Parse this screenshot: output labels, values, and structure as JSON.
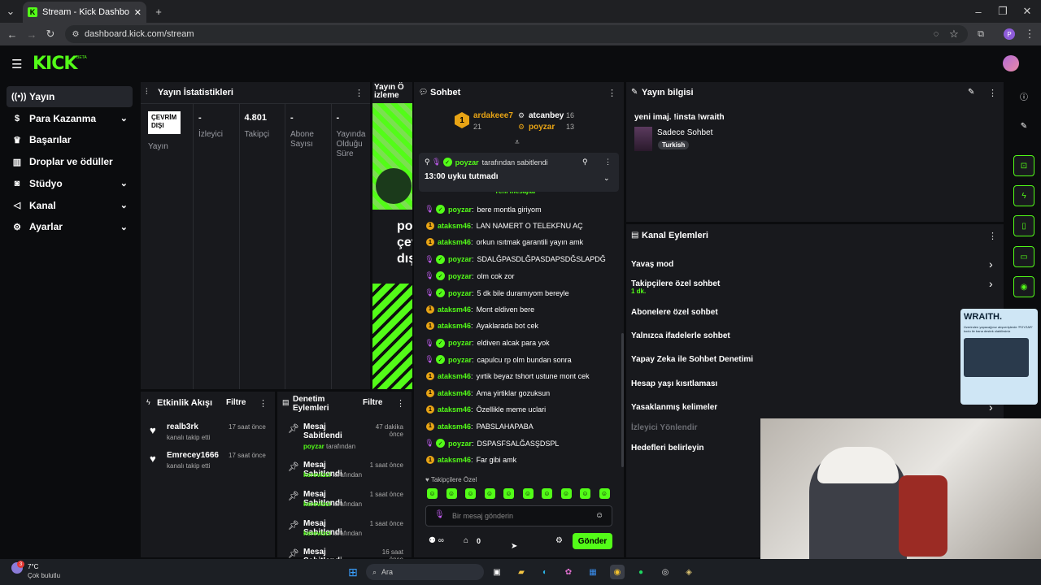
{
  "browser": {
    "tab_title": "Stream - Kick Dashboard",
    "url": "dashboard.kick.com/stream",
    "profile_letter": "P"
  },
  "header": {
    "logo": "KICK",
    "beta": "BETA"
  },
  "sidebar": {
    "items": [
      {
        "label": "Yayın",
        "icon": "broadcast-icon",
        "active": true
      },
      {
        "label": "Para Kazanma",
        "icon": "dollar-icon",
        "chevron": true
      },
      {
        "label": "Başarılar",
        "icon": "trophy-icon"
      },
      {
        "label": "Droplar ve ödüller",
        "icon": "gift-icon"
      },
      {
        "label": "Stüdyo",
        "icon": "camera-icon",
        "chevron": true
      },
      {
        "label": "Kanal",
        "icon": "megaphone-icon",
        "chevron": true
      },
      {
        "label": "Ayarlar",
        "icon": "gear-icon",
        "chevron": true
      }
    ]
  },
  "stats": {
    "title": "Yayın İstatistikleri",
    "status_badge": "ÇEVRİM DIŞI",
    "status_label": "Yayın",
    "cols": [
      {
        "value": "-",
        "label": "İzleyici"
      },
      {
        "value": "4.801",
        "label": "Takipçi"
      },
      {
        "value": "-",
        "label": "Abone Sayısı"
      },
      {
        "value": "-",
        "label": "Yayında Olduğu Süre"
      }
    ]
  },
  "preview": {
    "title": "Yayın Ö izleme",
    "overlay": "poy çev dışı"
  },
  "chat": {
    "title": "Sohbet",
    "top_gifters": [
      {
        "name": "ardakeee7",
        "count": "21",
        "rank": "1"
      },
      {
        "name": "atcanbey",
        "count": "16"
      },
      {
        "name": "poyzar",
        "count": "13"
      }
    ],
    "pinned": {
      "by": "poyzar",
      "suffix": "tarafından sabitlendi",
      "text": "13:00 uyku tutmadı"
    },
    "new_messages": "Yeni mesajlar",
    "messages": [
      {
        "user": "poyzar",
        "badge": "mod",
        "text": "bere montla giriyom"
      },
      {
        "user": "ataksm46",
        "badge": "sub",
        "text": "LAN NAMERT O TELEKFNU AÇ"
      },
      {
        "user": "ataksm46",
        "badge": "sub",
        "text": "orkun ısıtmak garantili yayın amk"
      },
      {
        "user": "poyzar",
        "badge": "mod",
        "text": "SDALĞPASDLĞPASDAPSDĞSLAPDĞ"
      },
      {
        "user": "poyzar",
        "badge": "mod",
        "text": "olm cok zor"
      },
      {
        "user": "poyzar",
        "badge": "mod",
        "text": "5 dk bile duramıyom bereyle"
      },
      {
        "user": "ataksm46",
        "badge": "sub",
        "text": "Mont eldiven bere"
      },
      {
        "user": "ataksm46",
        "badge": "sub",
        "text": "Ayaklarada bot cek"
      },
      {
        "user": "poyzar",
        "badge": "mod",
        "text": "eldiven alcak para yok"
      },
      {
        "user": "poyzar",
        "badge": "mod",
        "text": "capulcu rp olm bundan sonra"
      },
      {
        "user": "ataksm46",
        "badge": "sub",
        "text": "yırtik beyaz tshort ustune mont cek"
      },
      {
        "user": "ataksm46",
        "badge": "sub",
        "text": "Ama yirtiklar gozuksun"
      },
      {
        "user": "ataksm46",
        "badge": "sub",
        "text": "Özellikle meme uclari"
      },
      {
        "user": "ataksm46",
        "badge": "sub",
        "text": "PABSLAHAPABA"
      },
      {
        "user": "poyzar",
        "badge": "mod",
        "text": "DSPASFSALĞASŞDSPL"
      },
      {
        "user": "ataksm46",
        "badge": "sub",
        "text": "Far gibi amk"
      }
    ],
    "followers_only": "Takipçilere Özel",
    "input_placeholder": "Bir mesaj gönderin",
    "points": "0",
    "send": "Gönder"
  },
  "info": {
    "title": "Yayın bilgisi",
    "stream_title": "yeni imaj. !insta !wraith",
    "category": "Sadece Sohbet",
    "language": "Turkish"
  },
  "channel_actions": {
    "title": "Kanal Eylemleri",
    "items": [
      {
        "label": "Yavaş mod",
        "arrow": true
      },
      {
        "label": "Takipçilere özel sohbet",
        "sub": "1 dk.",
        "arrow": true
      },
      {
        "label": "Abonelere özel sohbet"
      },
      {
        "label": "Yalnızca ifadelerle sohbet"
      },
      {
        "label": "Yapay Zeka ile Sohbet Denetimi"
      },
      {
        "label": "Hesap yaşı kısıtlaması"
      },
      {
        "label": "Yasaklanmış kelimeler",
        "arrow": true
      },
      {
        "label": "İzleyici Yönlendir",
        "muted": true
      },
      {
        "label": "Hedefleri belirleyin"
      }
    ]
  },
  "activity": {
    "title": "Etkinlik Akışı",
    "filter": "Filtre",
    "items": [
      {
        "name": "realb3rk",
        "action": "kanalı takip etti",
        "time": "17 saat önce"
      },
      {
        "name": "Emrecey1666",
        "action": "kanalı takip etti",
        "time": "17 saat önce"
      }
    ]
  },
  "moderation": {
    "title": "Denetim Eylemleri",
    "filter": "Filtre",
    "items": [
      {
        "action": "Mesaj Sabitlendi",
        "by": "poyzar",
        "suffix": "tarafından",
        "time": "47 dakika önce"
      },
      {
        "action": "Mesaj Sabitlendi",
        "by": "kerevizci",
        "suffix": "tarafından",
        "time": "1 saat önce"
      },
      {
        "action": "Mesaj Sabitlendi",
        "by": "kerevizci",
        "suffix": "tarafından",
        "time": "1 saat önce"
      },
      {
        "action": "Mesaj Sabitlendi",
        "by": "kerevizci",
        "suffix": "tarafından",
        "time": "1 saat önce"
      },
      {
        "action": "Mesaj Sabitlendi",
        "by": "",
        "suffix": "",
        "time": "16 saat önce"
      }
    ]
  },
  "ad": {
    "brand": "WRAITH.",
    "text": "Üzerinden yapacağınız alışverişlerde 'POYZAR' kodu ile bana destek olabilirsiniz"
  },
  "taskbar": {
    "weather_temp": "7°C",
    "weather_desc": "Çok bulutlu",
    "search": "Ara",
    "notif": "3"
  },
  "colors": {
    "accent": "#53fc18",
    "panel": "#18191d",
    "bg": "#0b0c0e",
    "sub_badge": "#e8a415",
    "mod_badge": "#c45df2"
  }
}
